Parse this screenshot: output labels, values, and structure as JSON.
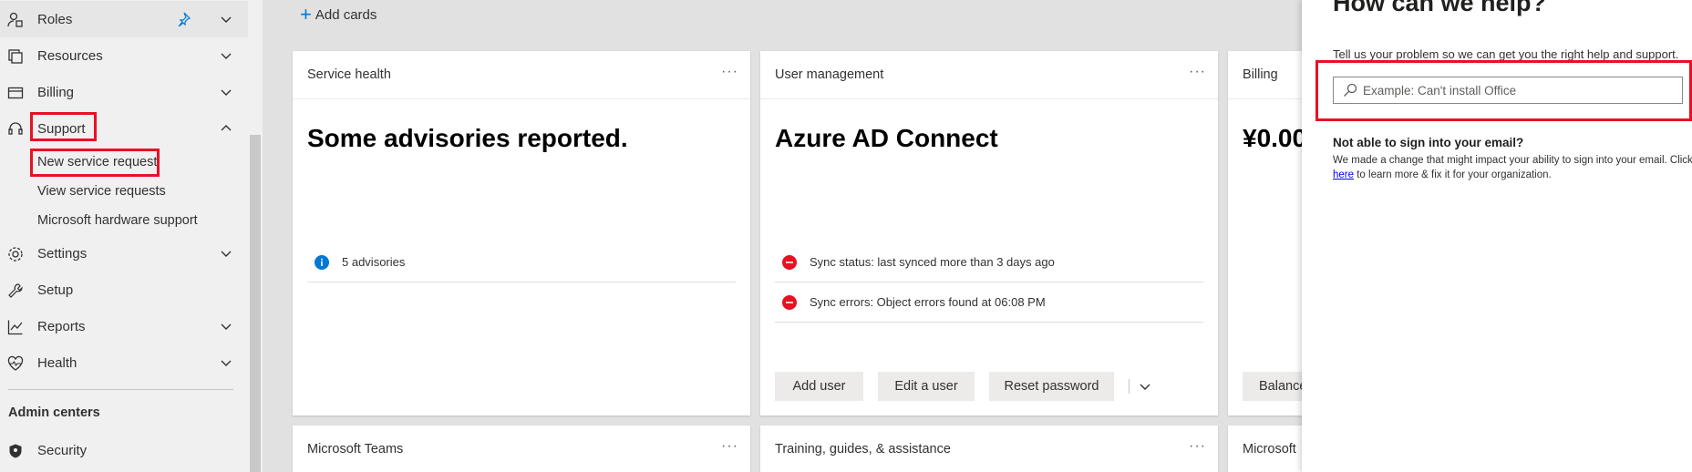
{
  "sidebar": {
    "items": [
      {
        "label": "Roles",
        "icon": "roles-icon"
      },
      {
        "label": "Resources",
        "icon": "resources-icon"
      },
      {
        "label": "Billing",
        "icon": "billing-icon"
      },
      {
        "label": "Support",
        "icon": "headset-icon"
      },
      {
        "label": "Settings",
        "icon": "gear-icon"
      },
      {
        "label": "Setup",
        "icon": "wrench-icon"
      },
      {
        "label": "Reports",
        "icon": "chart-icon"
      },
      {
        "label": "Health",
        "icon": "heart-icon"
      }
    ],
    "support_sub": [
      "New service request",
      "View service requests",
      "Microsoft hardware support"
    ],
    "admin_centers_title": "Admin centers",
    "security_label": "Security"
  },
  "main": {
    "add_cards_label": "Add cards",
    "cards": {
      "service_health": {
        "title": "Service health",
        "headline": "Some advisories reported.",
        "rows": [
          "5 advisories"
        ]
      },
      "user_management": {
        "title": "User management",
        "headline": "Azure AD Connect",
        "rows": [
          "Sync status: last synced more than 3 days ago",
          "Sync errors: Object errors found at 06:08 PM"
        ],
        "buttons": [
          "Add user",
          "Edit a user",
          "Reset password"
        ]
      },
      "billing": {
        "title": "Billing",
        "headline": "¥0.00",
        "button": "Balance"
      },
      "teams": {
        "title": "Microsoft Teams"
      },
      "training": {
        "title": "Training, guides, & assistance"
      },
      "microsoft_partial": {
        "title": "Microsoft"
      }
    },
    "more_glyph": "···"
  },
  "help_panel": {
    "title": "How can we help?",
    "subtitle": "Tell us your problem so we can get you the right help and support.",
    "search_placeholder": "Example: Can't install Office",
    "notice_title": "Not able to sign into your email?",
    "notice_line1": "We made a change that might impact your ability to sign into your email. Click",
    "notice_link": "here",
    "notice_line2": " to learn more & fix it for your organization."
  },
  "colors": {
    "accent": "#0078d4",
    "highlight_red": "#e81123",
    "error_red": "#e81123",
    "info_blue": "#0078d4"
  }
}
